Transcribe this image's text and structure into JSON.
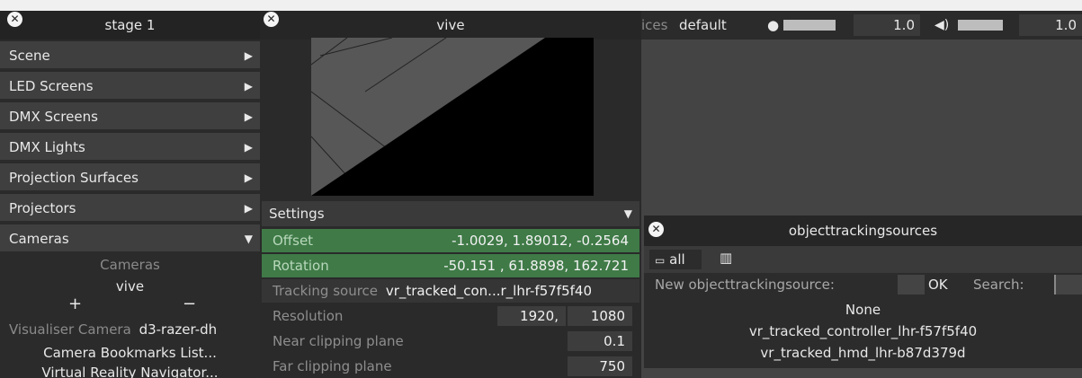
{
  "stage": {
    "title": "stage 1",
    "menu": [
      {
        "label": "Scene",
        "arrow": "▶"
      },
      {
        "label": "LED Screens",
        "arrow": "▶"
      },
      {
        "label": "DMX Screens",
        "arrow": "▶"
      },
      {
        "label": "DMX Lights",
        "arrow": "▶"
      },
      {
        "label": "Projection Surfaces",
        "arrow": "▶"
      },
      {
        "label": "Projectors",
        "arrow": "▶"
      },
      {
        "label": "Cameras",
        "arrow": "▼"
      }
    ],
    "cameras": {
      "header": "Cameras",
      "item": "vive",
      "add": "+",
      "remove": "−",
      "visualiser_label": "Visualiser Camera",
      "visualiser_value": "d3-razer-dh",
      "bookmarks": "Camera Bookmarks List...",
      "vr_nav": "Virtual Reality Navigator..."
    }
  },
  "vive": {
    "title": "vive",
    "settings_label": "Settings",
    "settings_arrow": "▼",
    "offset_label": "Offset",
    "offset_value": "-1.0029, 1.89012, -0.2564",
    "rotation_label": "Rotation",
    "rotation_value": "-50.151 , 61.8898, 162.721",
    "tracking_label": "Tracking source",
    "tracking_value": "vr_tracked_con...r_lhr-f57f5f40",
    "resolution_label": "Resolution",
    "resolution_w": "1920,",
    "resolution_h": "1080",
    "near_label": "Near clipping plane",
    "near_value": "0.1",
    "far_label": "Far clipping plane",
    "far_value": "750"
  },
  "topbar": {
    "devices_partial": "ices",
    "devices_value": "default",
    "brightness_value": "1.0",
    "volume_value": "1.0"
  },
  "ots": {
    "title": "objecttrackingsources",
    "all_label": "all",
    "new_label": "New objecttrackingsource:",
    "ok_label": "OK",
    "search_label": "Search:",
    "items": [
      "None",
      "vr_tracked_controller_lhr-f57f5f40",
      "vr_tracked_hmd_lhr-b87d379d"
    ]
  },
  "icons": {
    "close": "close-icon",
    "bulb": "light-bulb-icon",
    "speaker": "speaker-icon",
    "monitor": "monitor-icon",
    "trash": "trash-icon"
  }
}
